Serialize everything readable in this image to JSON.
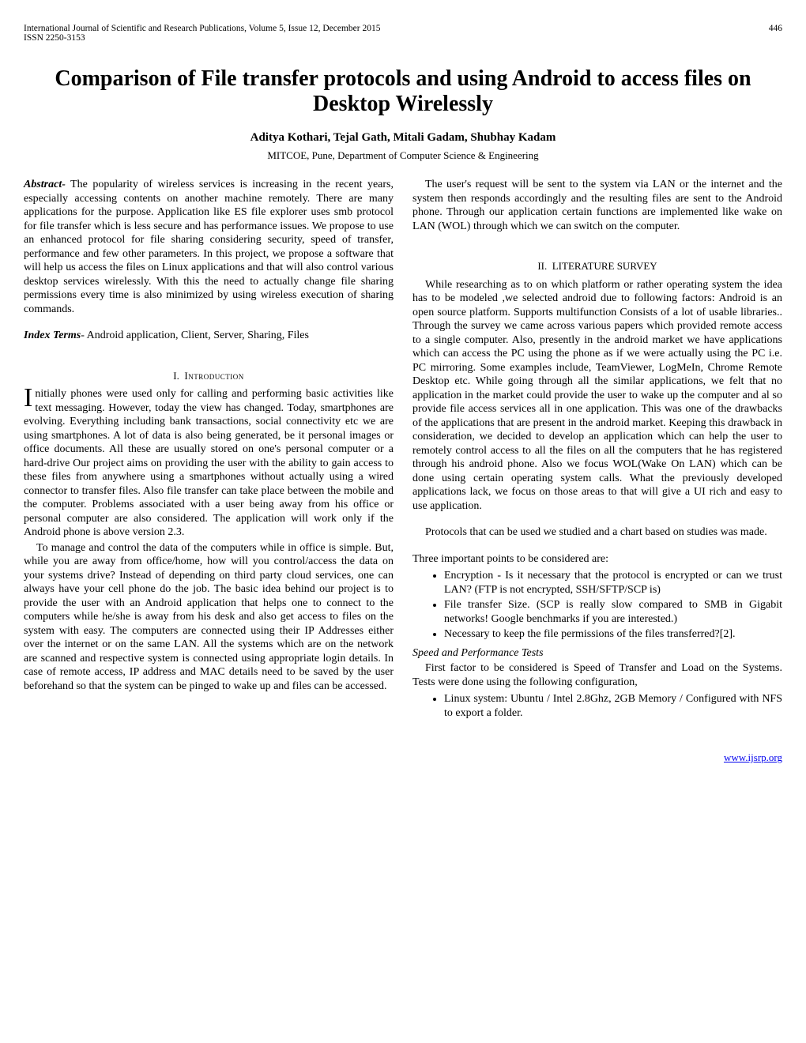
{
  "header": {
    "journal": "International Journal of Scientific and Research Publications, Volume 5, Issue 12, December 2015",
    "issn": "ISSN 2250-3153",
    "page_no": "446"
  },
  "title": "Comparison of File transfer protocols and using Android to access files on Desktop Wirelessly",
  "authors": "Aditya Kothari, Tejal Gath, Mitali Gadam, Shubhay Kadam",
  "affiliation": "MITCOE, Pune, Department of Computer Science & Engineering",
  "abstract_label": "Abstract-",
  "abstract_text": " The popularity of wireless services is increasing in the recent years, especially accessing contents on another machine remotely. There are many applications for the purpose. Application like ES file explorer uses smb protocol for file transfer which is less secure and has performance issues. We propose to use an enhanced protocol for file sharing considering security, speed of transfer, performance and few other parameters. In this project, we propose a software that will help us access the files on Linux applications and that will also control various desktop services wirelessly. With this the need to actually change file sharing permissions every time is also minimized by using wireless execution of sharing commands.",
  "index_label": "Index Terms",
  "index_text": "- Android application, Client, Server, Sharing, Files",
  "sec1_num": "I.",
  "sec1_title": "Introduction",
  "intro_p1": "Initially phones were used only for calling and performing basic activities like text messaging. However, today the view has changed. Today, smartphones are evolving. Everything including bank transactions, social connectivity etc we are using smartphones. A lot of data is also being generated, be it personal images or office documents. All these are usually stored on one's personal computer or a hard-drive Our project aims on providing the user with the ability to gain access to these files from anywhere using a smartphones without actually using a wired connector to transfer files. Also file transfer can take place between the mobile and the computer. Problems associated with a user being away from his office or personal computer are also considered. The application will work only if the Android phone is above version 2.3.",
  "intro_p2": "To manage and control the data of the computers while in office is simple. But, while you are away from office/home, how will you control/access the data on your systems drive? Instead of depending on third party cloud services, one can always have your cell phone do the job. The basic idea behind our project is to provide the user with an Android application that helps one to connect to the computers while he/she is away from his desk and also get access to files on the system with easy. The computers are connected using their IP Addresses either over the internet or on the same LAN.  All the systems which are on the network are scanned and respective system is connected using appropriate login details. In case of remote access, IP address and MAC details need to be saved by the user beforehand so that the system can be pinged to wake up and files can be accessed.",
  "intro_p3": "The user's request will be sent to the system via LAN or the internet and the system then responds accordingly and the resulting files are sent to the Android phone. Through our application certain functions are implemented like wake on LAN (WOL) through which we can switch on the computer.",
  "sec2_num": "II.",
  "sec2_title": "LITERATURE SURVEY",
  "lit_p1": "While researching as to on which platform or rather operating system the idea has to be modeled ,we selected android due to following factors: Android is an open source platform. Supports multifunction Consists of a lot of usable libraries.. Through the survey we came across various papers which provided remote access to a single computer. Also, presently in the android market we have applications which can access the PC using the phone as if we were actually using the PC i.e. PC mirroring. Some examples include, TeamViewer, LogMeIn, Chrome Remote Desktop etc. While going through all the similar applications, we felt that no application in the market could provide the user to wake up the computer and al so provide file access services all in one application. This was one of the drawbacks of the applications that are present in the android market. Keeping this drawback in consideration, we decided to develop an application which can help the user to remotely control access to all the files on all the computers that he has registered through his android phone. Also we focus WOL(Wake On LAN) which can be done using certain operating system calls. What the previously developed applications lack, we focus on those areas to that will give a UI rich and easy to use application.",
  "lit_p2": "Protocols that  can be used we studied and a chart based on studies was made.",
  "points_intro": "Three important points to be considered are:",
  "point1": "Encryption - Is it necessary that the protocol is encrypted or can we trust LAN? (FTP is not encrypted, SSH/SFTP/SCP is)",
  "point2": "File transfer Size. (SCP is really slow compared to SMB in Gigabit networks! Google benchmarks if you are interested.)",
  "point3": "Necessary to keep the file permissions of the files transferred?[2].",
  "speed_head": "Speed and Performance Tests",
  "speed_p1": "First factor to be considered is Speed of Transfer and Load on the Systems. Tests were done using the following configuration,",
  "speed_bullet1": "Linux system: Ubuntu / Intel 2.8Ghz, 2GB Memory / Configured with NFS to export a folder.",
  "footer_link": "www.ijsrp.org"
}
